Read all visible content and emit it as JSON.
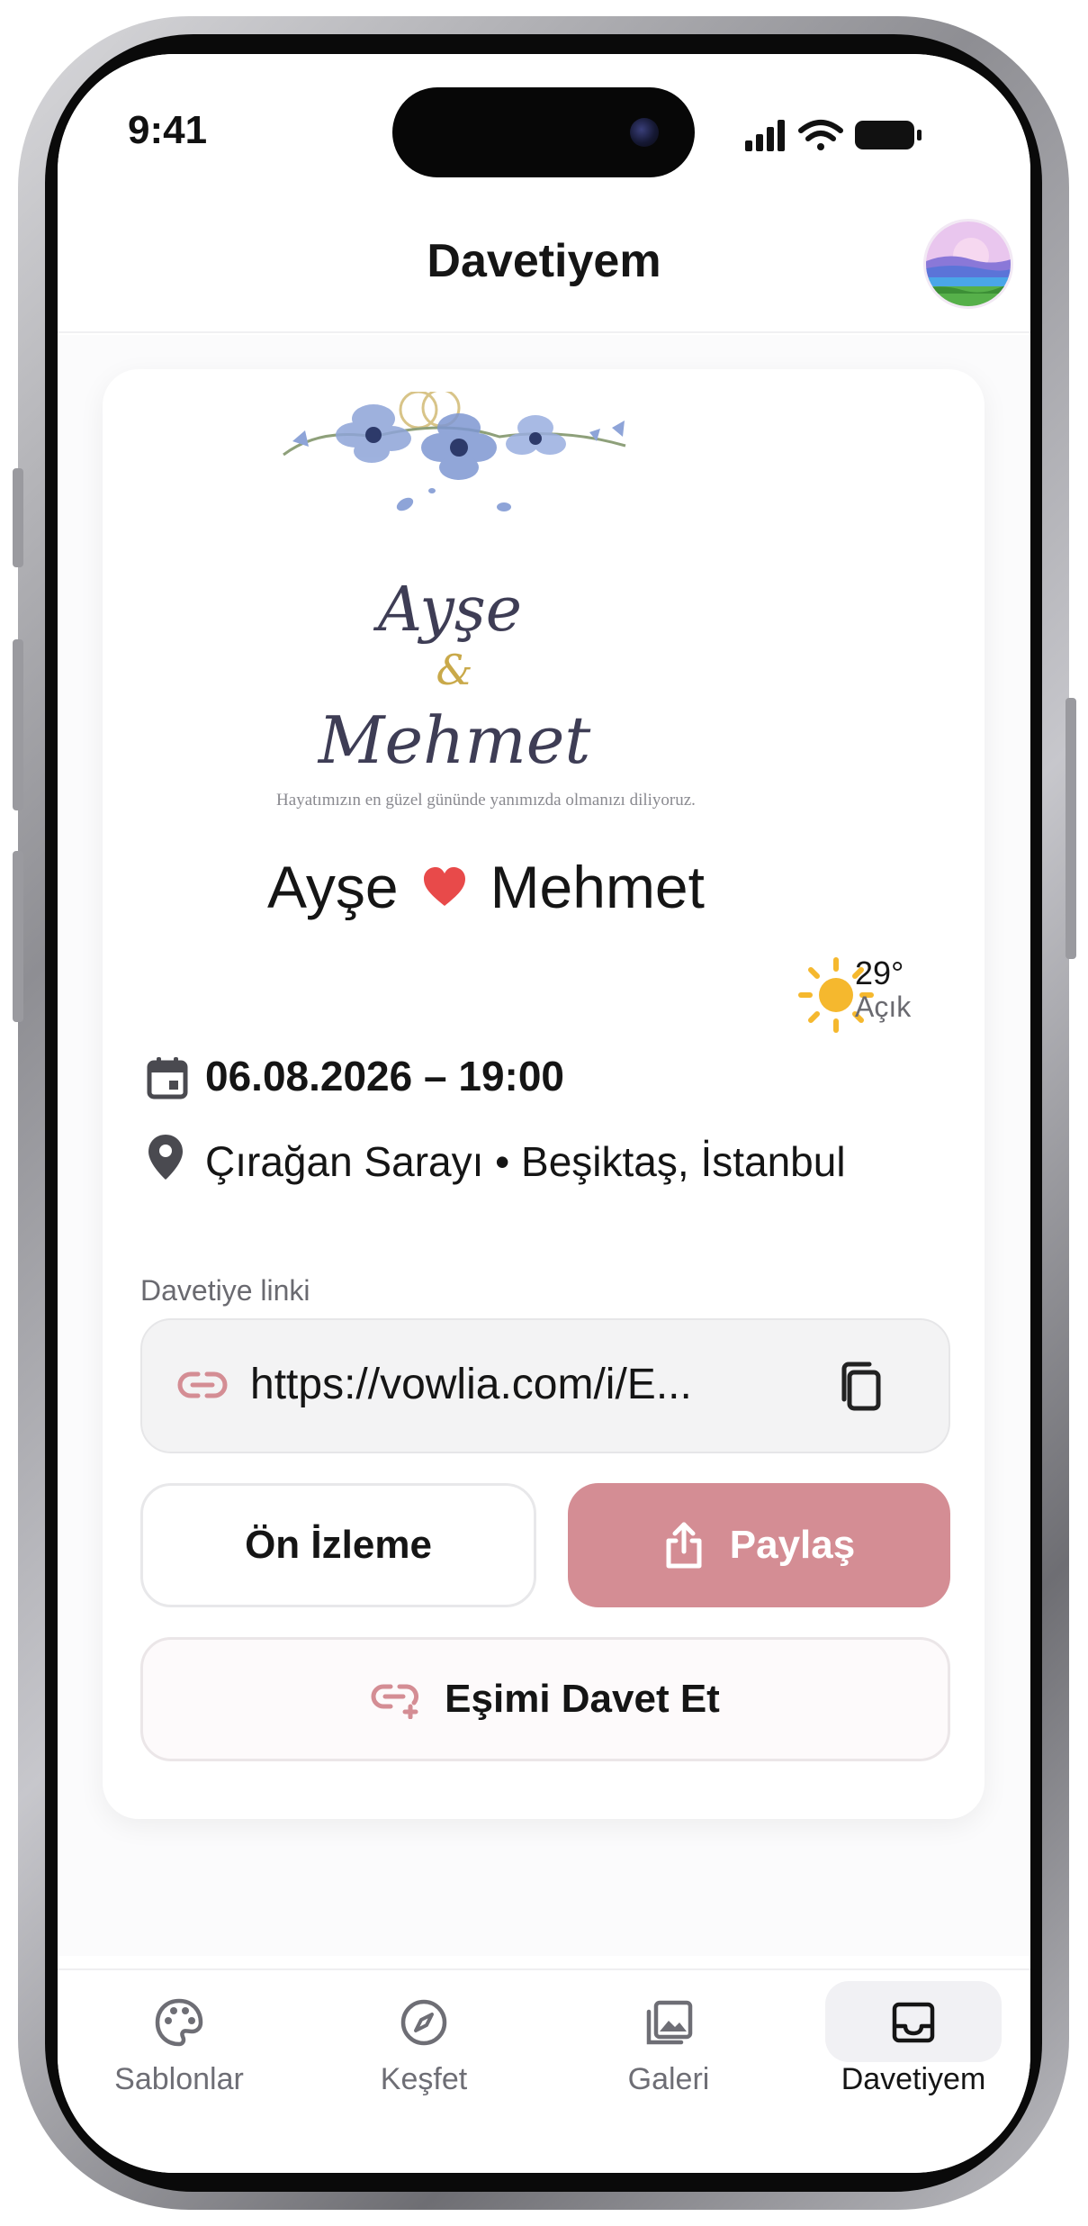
{
  "status_bar": {
    "time": "9:41"
  },
  "header": {
    "title": "Davetiyem"
  },
  "invitation_card": {
    "bride": "Ayşe",
    "ampersand": "&",
    "groom": "Mehmet",
    "tagline": "Hayatımızın en güzel gününde yanımızda olmanızı diliyoruz."
  },
  "couple": {
    "first": "Ayşe",
    "second": "Mehmet"
  },
  "weather": {
    "temperature": "29°",
    "condition": "Açık"
  },
  "event": {
    "datetime": "06.08.2026 – 19:00",
    "location": "Çırağan Sarayı • Beşiktaş, İstanbul"
  },
  "link": {
    "label": "Davetiye linki",
    "url": "https://vowlia.com/i/E..."
  },
  "buttons": {
    "preview": "Ön İzleme",
    "share": "Paylaş",
    "invite_partner": "Eşimi Davet Et"
  },
  "tabs": [
    {
      "label": "Sablonlar",
      "icon": "palette-icon"
    },
    {
      "label": "Keşfet",
      "icon": "compass-icon"
    },
    {
      "label": "Galeri",
      "icon": "gallery-icon"
    },
    {
      "label": "Davetiyem",
      "icon": "inbox-icon",
      "active": true
    }
  ],
  "colors": {
    "accent": "#d48d94",
    "heart": "#e84a4a",
    "sun": "#f5b82e",
    "floral": "#8ea4d8"
  }
}
